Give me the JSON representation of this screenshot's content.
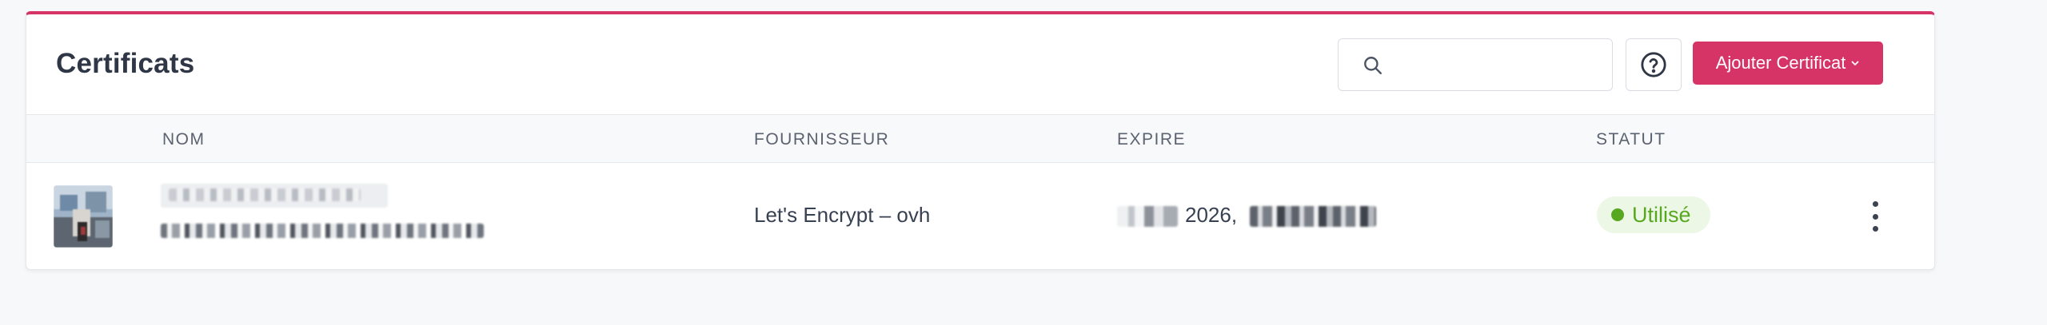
{
  "header": {
    "title": "Certificats",
    "search": {
      "placeholder": "",
      "value": "",
      "icon": "search-icon"
    },
    "help_icon": "question-circle-icon",
    "add_button": {
      "label": "Ajouter Certificat",
      "icon": "chevron-down-icon"
    }
  },
  "table": {
    "columns": [
      "NOM",
      "FOURNISSEUR",
      "EXPIRE",
      "STATUT"
    ],
    "rows": [
      {
        "provider": "Let's Encrypt – ovh",
        "expires_year": "2026,",
        "status": "Utilisé",
        "menu_icon": "more-vertical-icon"
      }
    ]
  },
  "colors": {
    "accent": "#d63367",
    "status_green": "#58a81f",
    "status_bg": "#edf7e6",
    "title": "#2f3645"
  }
}
